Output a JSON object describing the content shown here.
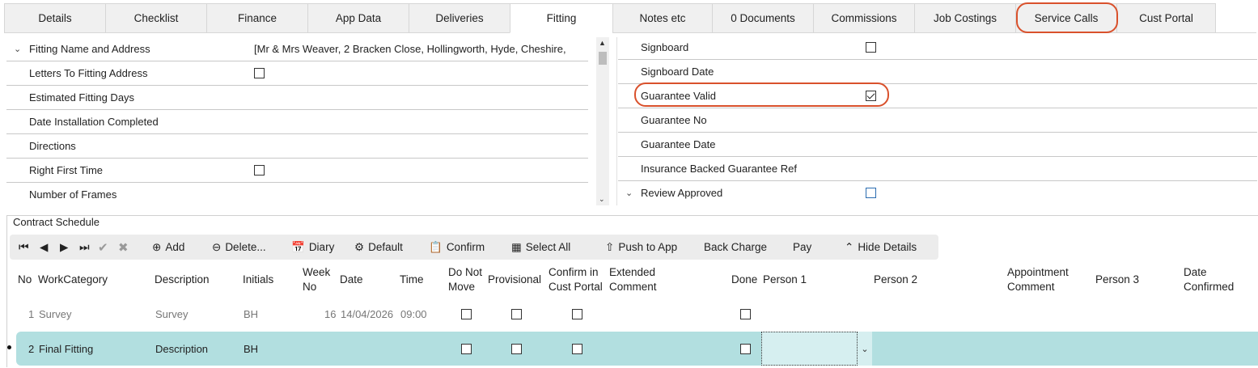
{
  "tabs": [
    {
      "label": "Details"
    },
    {
      "label": "Checklist"
    },
    {
      "label": "Finance"
    },
    {
      "label": "App Data"
    },
    {
      "label": "Deliveries"
    },
    {
      "label": "Fitting"
    },
    {
      "label": "Notes etc"
    },
    {
      "label": "0 Documents"
    },
    {
      "label": "Commissions"
    },
    {
      "label": "Job Costings"
    },
    {
      "label": "Service Calls"
    },
    {
      "label": "Cust Portal"
    }
  ],
  "active_tab": "Fitting",
  "left_fields": [
    {
      "label": "Fitting Name and Address",
      "value": "[Mr & Mrs  Weaver, 2 Bracken Close, Hollingworth, Hyde, Cheshire,",
      "expander": true
    },
    {
      "label": "Letters To Fitting Address",
      "checkbox": false
    },
    {
      "label": "Estimated Fitting Days"
    },
    {
      "label": "Date Installation Completed"
    },
    {
      "label": "Directions"
    },
    {
      "label": "Right First Time",
      "checkbox": false
    },
    {
      "label": "Number of Frames"
    }
  ],
  "right_fields": [
    {
      "label": "Signboard",
      "checkbox": false
    },
    {
      "label": "Signboard Date"
    },
    {
      "label": "Guarantee Valid",
      "checkbox": true
    },
    {
      "label": "Guarantee No"
    },
    {
      "label": "Guarantee Date"
    },
    {
      "label": "Insurance Backed Guarantee Ref"
    },
    {
      "label": "Review Approved",
      "checkbox": false,
      "expander": true
    }
  ],
  "contract_schedule": {
    "title": "Contract Schedule",
    "toolbar": {
      "add": "Add",
      "delete": "Delete...",
      "diary": "Diary",
      "default": "Default",
      "confirm": "Confirm",
      "select_all": "Select All",
      "push_to_app": "Push to App",
      "back_charge": "Back Charge",
      "pay": "Pay",
      "hide_details": "Hide Details"
    },
    "columns": {
      "no": "No",
      "work_category": "WorkCategory",
      "description": "Description",
      "initials": "Initials",
      "week_no_1": "Week",
      "week_no_2": "No",
      "date": "Date",
      "time": "Time",
      "do_not_move_1": "Do Not",
      "do_not_move_2": "Move",
      "provisional": "Provisional",
      "confirm_portal_1": "Confirm in",
      "confirm_portal_2": "Cust Portal",
      "extended_comment_1": "Extended",
      "extended_comment_2": "Comment",
      "done": "Done",
      "person1": "Person 1",
      "person2": "Person 2",
      "appointment_comment_1": "Appointment",
      "appointment_comment_2": "Comment",
      "person3": "Person 3",
      "date_confirmed_1": "Date",
      "date_confirmed_2": "Confirmed"
    },
    "rows": [
      {
        "no": "1",
        "work_category": "Survey",
        "description": "Survey",
        "initials": "BH",
        "week_no": "16",
        "date": "14/04/2026",
        "time": "09:00"
      },
      {
        "no": "2",
        "work_category": "Final Fitting",
        "description": "Description",
        "initials": "BH",
        "week_no": "",
        "date": "",
        "time": ""
      }
    ]
  }
}
